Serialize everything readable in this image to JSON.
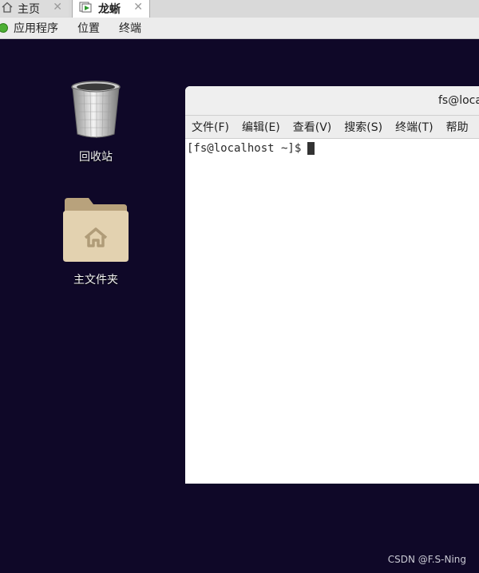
{
  "tabs": [
    {
      "label": "主页",
      "active": false
    },
    {
      "label": "龙蜥",
      "active": true
    }
  ],
  "topbar": {
    "applications": "应用程序",
    "places": "位置",
    "terminal": "终端"
  },
  "desktop": {
    "trash_label": "回收站",
    "home_folder_label": "主文件夹"
  },
  "terminal_window": {
    "title": "fs@loca",
    "menu": [
      "文件(F)",
      "编辑(E)",
      "查看(V)",
      "搜索(S)",
      "终端(T)",
      "帮助"
    ],
    "prompt": "[fs@localhost ~]$"
  },
  "watermark": "CSDN @F.S-Ning",
  "colors": {
    "desktop_bg": "#0f0828",
    "apps_green": "#4caf33",
    "folder_tan": "#e3d2b0"
  }
}
